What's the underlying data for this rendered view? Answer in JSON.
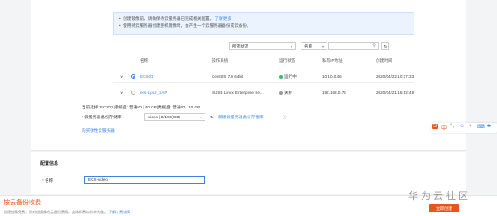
{
  "notice": {
    "line1": "创建镜像前，请确保待云服务器已完成相关配置。",
    "line1_link": "了解更多",
    "line2": "使用待云服务器创建整机镜像时，会产生一个云服务器备份或云备份。"
  },
  "filters": {
    "status_select": "所有状态",
    "name_select": "名称",
    "search_placeholder": ""
  },
  "table": {
    "headers": [
      "名称",
      "操作系统",
      "运行状态",
      "私有IP地址",
      "创建时间"
    ],
    "rows": [
      {
        "name": "ECS01",
        "os": "CentOS 7.6 64bit",
        "status": "运行中",
        "ip": "10.10.0.46",
        "created": "2020/04/22 10:17:33 G..."
      },
      {
        "name": "ecs-Lppz_SAP",
        "os": "SUSE Linux Enterprise Se...",
        "status": "关机",
        "ip": "192.168.0.75",
        "created": "2020/04/21 16:52:48 G..."
      }
    ]
  },
  "selection_info": "当前选择: ECS01|系统盘: 普通IO | 40 GB|数据盘: 普通IO | 10 GB",
  "vault": {
    "label": "云服务器备份存储库",
    "select_value": "video | 0/100(GB)",
    "create_link": "新建云服务器备份存储库",
    "purchase_link": "购买弹性云服务器"
  },
  "config": {
    "section_title": "配置信息",
    "name_label": "名称",
    "name_value": "ECS-video"
  },
  "bottom": {
    "title": "按云备份收费",
    "desc": "创建镜像免费，但对应镜像的云备份费用，具体扣费以账单为准。",
    "desc_link": "了解计费详情",
    "button": "立即创建",
    "watermark": "华为云社区"
  },
  "toolbar_icons": [
    "S",
    "中",
    "°,",
    "☺",
    "♀",
    "⌨",
    "♣"
  ],
  "colors": {
    "accent": "#3b86e0",
    "danger": "#e03b3b",
    "running": "#3cb878",
    "stopped": "#999999"
  }
}
